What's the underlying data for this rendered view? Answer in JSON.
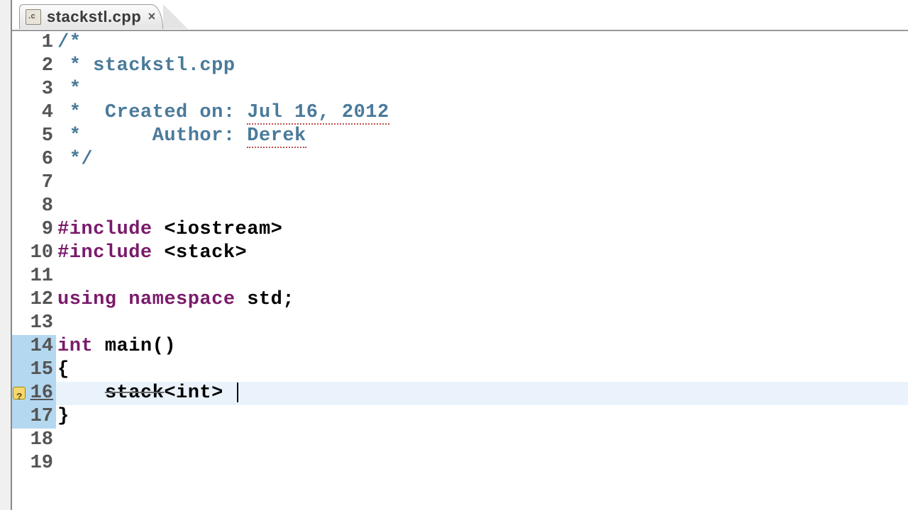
{
  "tab": {
    "filename": "stackstl.cpp",
    "close_glyph": "×"
  },
  "code": {
    "lines": [
      {
        "n": 1,
        "type": "comment",
        "text": "/*"
      },
      {
        "n": 2,
        "type": "comment",
        "text": " * stackstl.cpp"
      },
      {
        "n": 3,
        "type": "comment",
        "text": " *"
      },
      {
        "n": 4,
        "type": "comment-date",
        "prefix": " *  Created on: ",
        "date": "Jul 16, 2012"
      },
      {
        "n": 5,
        "type": "comment-author",
        "prefix": " *      Author: ",
        "author": "Derek"
      },
      {
        "n": 6,
        "type": "comment",
        "text": " */"
      },
      {
        "n": 7,
        "type": "blank",
        "text": ""
      },
      {
        "n": 8,
        "type": "blank",
        "text": ""
      },
      {
        "n": 9,
        "type": "include",
        "kw": "#include",
        "hdr": " <iostream>"
      },
      {
        "n": 10,
        "type": "include",
        "kw": "#include",
        "hdr": " <stack>"
      },
      {
        "n": 11,
        "type": "blank",
        "text": ""
      },
      {
        "n": 12,
        "type": "using",
        "kw1": "using",
        "mid": " ",
        "kw2": "namespace",
        "rest": " std;"
      },
      {
        "n": 13,
        "type": "blank",
        "text": ""
      },
      {
        "n": 14,
        "type": "funcsig",
        "kw": "int",
        "rest": " main()"
      },
      {
        "n": 15,
        "type": "plain",
        "text": "{"
      },
      {
        "n": 16,
        "type": "stackline",
        "indent": "    ",
        "ident": "stack",
        "rest": "<int> "
      },
      {
        "n": 17,
        "type": "plain",
        "text": "}"
      },
      {
        "n": 18,
        "type": "blank",
        "text": ""
      },
      {
        "n": 19,
        "type": "blank",
        "text": ""
      }
    ],
    "active_line": 16,
    "fn_scope_start": 14,
    "fn_scope_end": 17,
    "warning_line": 16
  }
}
